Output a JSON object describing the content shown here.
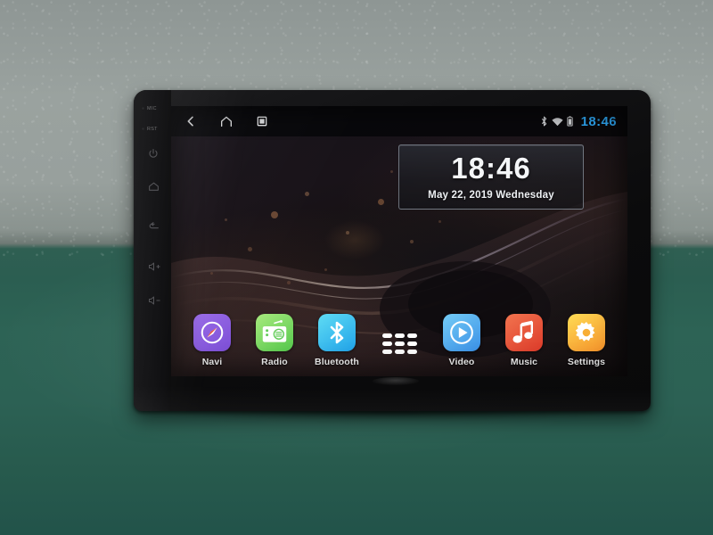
{
  "scene": {
    "description": "Android car head unit on green table against grey wall",
    "wall_color": "#98a09d",
    "table_color": "#2c6154",
    "device_color": "#101012"
  },
  "hardware_bezel": {
    "labels": [
      {
        "name": "mic",
        "text": "MIC"
      },
      {
        "name": "reset",
        "text": "RST"
      }
    ],
    "buttons": [
      {
        "name": "power",
        "icon": "power-icon"
      },
      {
        "name": "home",
        "icon": "home-icon"
      },
      {
        "name": "back",
        "icon": "back-arrow-icon"
      },
      {
        "name": "volume-up",
        "icon": "volume-up-icon"
      },
      {
        "name": "volume-down",
        "icon": "volume-down-icon"
      }
    ]
  },
  "statusbar": {
    "nav": [
      {
        "name": "back",
        "icon": "back-chevron-icon"
      },
      {
        "name": "home",
        "icon": "home-icon"
      },
      {
        "name": "recents",
        "icon": "recents-square-icon"
      }
    ],
    "indicators": [
      {
        "name": "bluetooth",
        "icon": "bluetooth-icon"
      },
      {
        "name": "wifi",
        "icon": "wifi-icon"
      },
      {
        "name": "battery",
        "icon": "battery-icon"
      }
    ],
    "time": "18:46",
    "time_color": "#2ea6f2"
  },
  "clock_widget": {
    "time": "18:46",
    "date": "May 22, 2019  Wednesday"
  },
  "dock": {
    "apps": [
      {
        "label": "Navi",
        "icon": "compass-icon",
        "color_from": "#9a6ce8",
        "color_to": "#7d4fd6"
      },
      {
        "label": "Radio",
        "icon": "radio-icon",
        "color_from": "#9fe87a",
        "color_to": "#54c94c"
      },
      {
        "label": "Bluetooth",
        "icon": "bluetooth-icon",
        "color_from": "#5ad9f2",
        "color_to": "#22a5e8"
      },
      {
        "label": "",
        "icon": "app-drawer-icon",
        "color_from": "transparent",
        "color_to": "transparent"
      },
      {
        "label": "Video",
        "icon": "play-circle-icon",
        "color_from": "#6fc9f5",
        "color_to": "#3a92e6"
      },
      {
        "label": "Music",
        "icon": "music-note-icon",
        "color_from": "#ef6a4a",
        "color_to": "#df3c2c"
      },
      {
        "label": "Settings",
        "icon": "gear-icon",
        "color_from": "#ffd94d",
        "color_to": "#f79a2b"
      }
    ]
  }
}
